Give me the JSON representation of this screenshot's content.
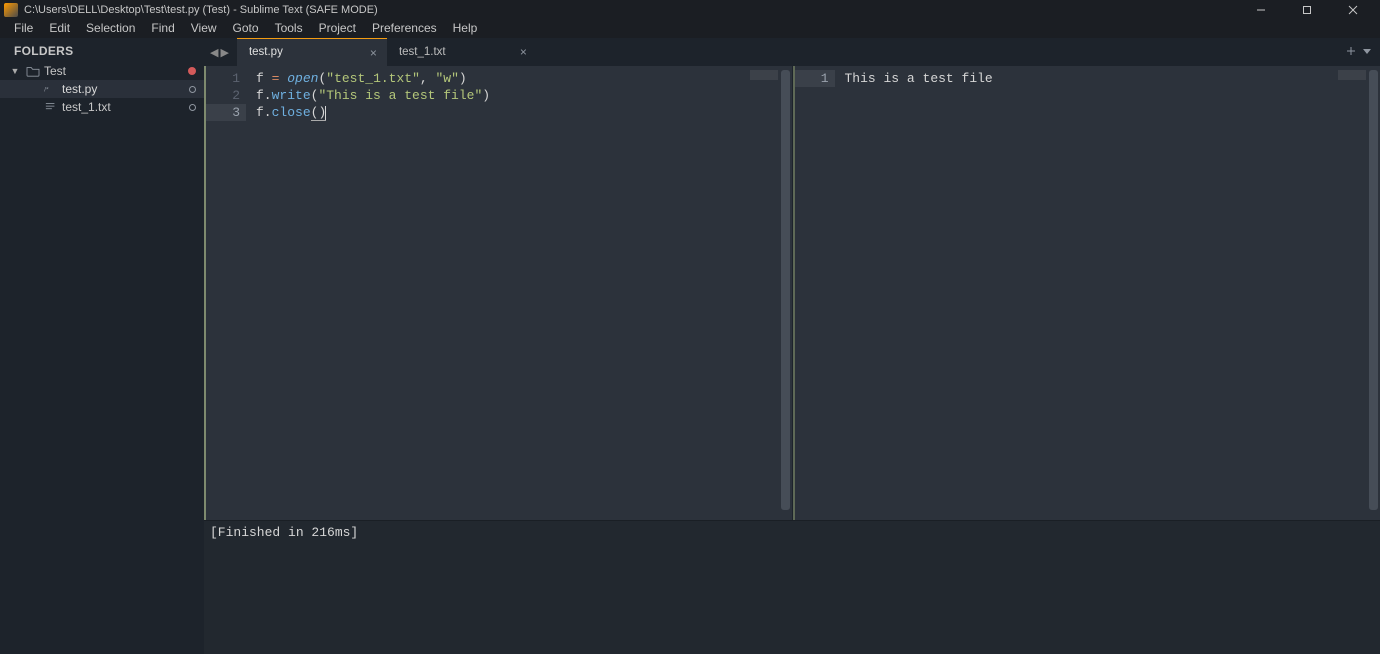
{
  "titlebar": {
    "title": "C:\\Users\\DELL\\Desktop\\Test\\test.py (Test) - Sublime Text (SAFE MODE)"
  },
  "menu": {
    "items": [
      "File",
      "Edit",
      "Selection",
      "Find",
      "View",
      "Goto",
      "Tools",
      "Project",
      "Preferences",
      "Help"
    ]
  },
  "sidebar": {
    "header": "FOLDERS",
    "nodes": [
      {
        "label": "Test",
        "type": "folder",
        "expanded": true,
        "status": "red"
      },
      {
        "label": "test.py",
        "type": "file-py",
        "status": "hollow",
        "active": true
      },
      {
        "label": "test_1.txt",
        "type": "file-txt",
        "status": "hollow"
      }
    ]
  },
  "tabs": {
    "items": [
      {
        "label": "test.py",
        "active": true
      },
      {
        "label": "test_1.txt",
        "active": false
      }
    ]
  },
  "editor_left": {
    "lines": [
      "1",
      "2",
      "3"
    ],
    "current_line": 3,
    "code": {
      "l1a": "f ",
      "l1op": "=",
      "l1b": " ",
      "l1fn": "open",
      "l1paren_o": "(",
      "l1s1": "\"test_1.txt\"",
      "l1comma": ", ",
      "l1s2": "\"w\"",
      "l1paren_c": ")",
      "l2a": "f.",
      "l2fn": "write",
      "l2paren_o": "(",
      "l2s": "\"This is a test file\"",
      "l2paren_c": ")",
      "l3a": "f.",
      "l3fn": "close",
      "l3paren_o": "(",
      "l3paren_c": ")"
    }
  },
  "editor_right": {
    "lines": [
      "1"
    ],
    "current_line": 1,
    "text": "This is a test file"
  },
  "output": {
    "text": "[Finished in 216ms]"
  }
}
